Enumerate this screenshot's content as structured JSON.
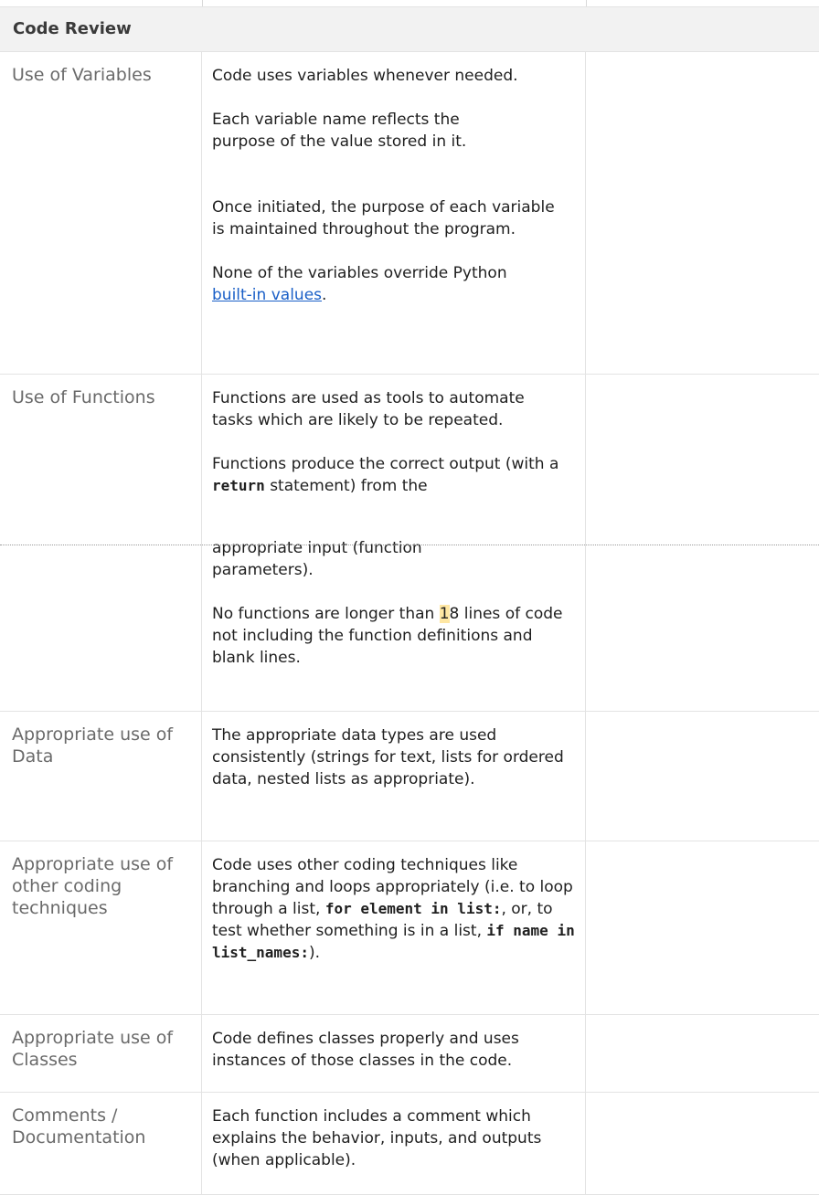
{
  "section": {
    "title": "Code Review"
  },
  "rows": {
    "variables": {
      "label": "Use of Variables",
      "p1": "Code uses variables whenever needed.",
      "p2": "Each variable name reflects the purpose of the value stored in it.",
      "p3": "Once initiated, the purpose of each variable is maintained throughout the program.",
      "p4_before": "None of the variables override Python",
      "p4_link": "built-in values",
      "p4_after": "."
    },
    "functions": {
      "label": "Use of Functions",
      "p1": "Functions are used as tools to automate tasks which are likely to be repeated.",
      "p2_before": "Functions produce the correct output (with a",
      "p2_code": "return",
      "p2_after": "statement) from the",
      "p3": "appropriate input (function parameters).",
      "p4_before": "No functions are longer than",
      "p4_hl": "1",
      "p4_after": "8 lines of code not including the function definitions and blank lines."
    },
    "data": {
      "label": "Appropriate use of Data",
      "p1": "The appropriate data types are used consistently (strings for text, lists for ordered data, nested lists as appropriate)."
    },
    "techniques": {
      "label": "Appropriate use of other coding techniques",
      "p1_a": "Code uses other coding techniques like branching and loops appropriately (i.e. to loop through a list,",
      "p1_code1": "for element in list:",
      "p1_b": ", or, to test whether something is in a list,",
      "p1_code2": "if name in list_names:",
      "p1_c": ")."
    },
    "classes": {
      "label": "Appropriate use of Classes",
      "p1": "Code defines classes properly and uses instances of those classes in the code."
    },
    "comments": {
      "label": "Comments / Documentation",
      "p1": "Each function includes a comment which explains the behavior, inputs, and outputs (when applicable)."
    }
  }
}
